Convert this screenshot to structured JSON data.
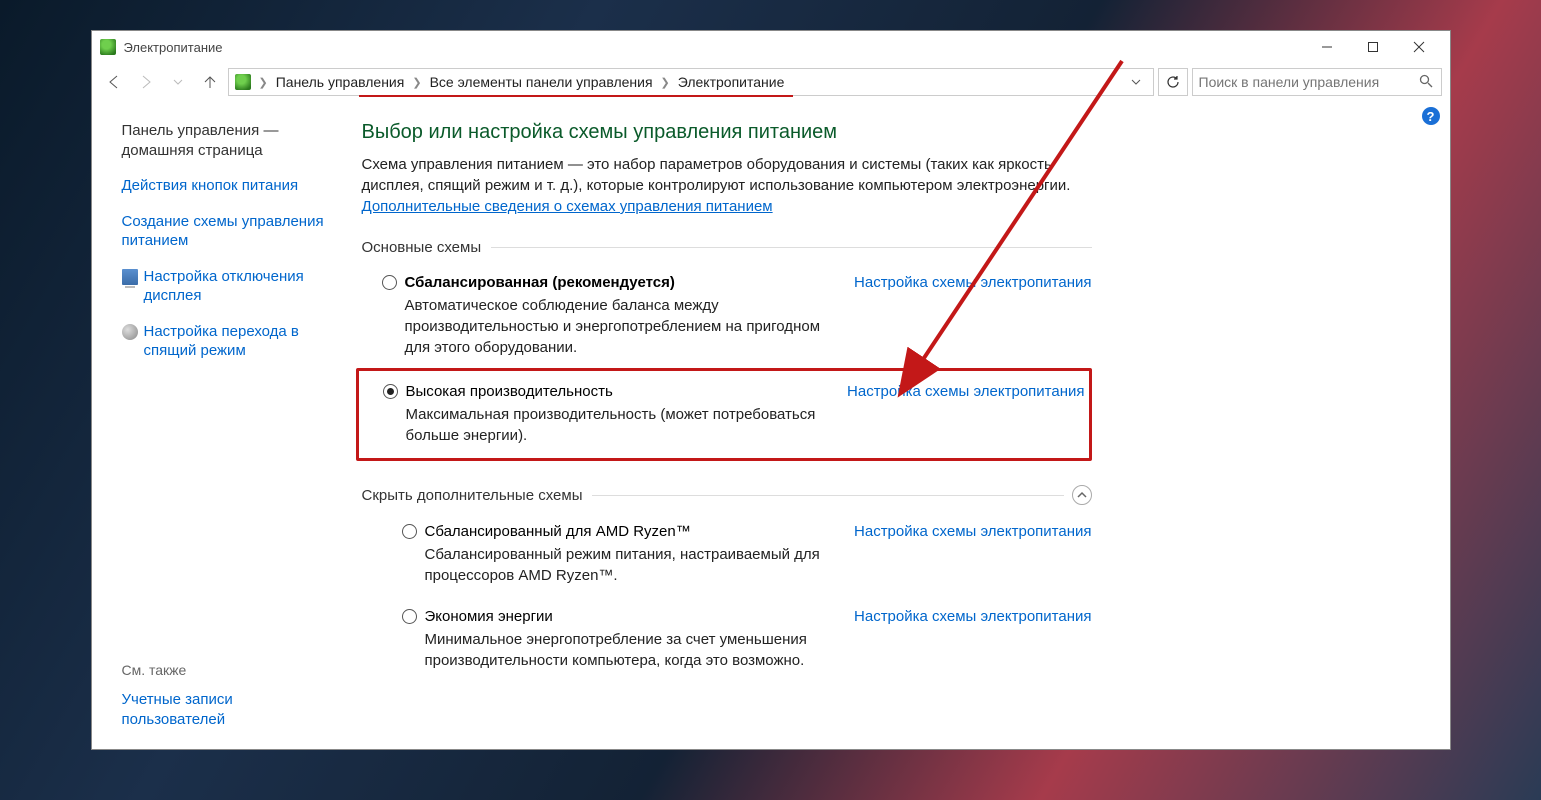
{
  "window": {
    "title": "Электропитание",
    "buttons": {
      "minimize": "—",
      "maximize": "□",
      "close": "✕"
    }
  },
  "nav": {
    "back": "←",
    "forward": "→",
    "up": "↑",
    "breadcrumb": {
      "item1": "Панель управления",
      "item2": "Все элементы панели управления",
      "item3": "Электропитание"
    },
    "search_placeholder": "Поиск в панели управления"
  },
  "sidebar": {
    "home1": "Панель управления —",
    "home2": "домашняя страница",
    "link_buttons": "Действия кнопок питания",
    "link_create1": "Создание схемы управления",
    "link_create2": "питанием",
    "link_display1": "Настройка отключения",
    "link_display2": "дисплея",
    "link_sleep1": "Настройка перехода в",
    "link_sleep2": "спящий режим"
  },
  "seealso": {
    "title": "См. также",
    "link1a": "Учетные записи",
    "link1b": "пользователей"
  },
  "main": {
    "heading": "Выбор или настройка схемы управления питанием",
    "desc": "Схема управления питанием — это набор параметров оборудования и системы (таких как яркость дисплея, спящий режим и т. д.), которые контролируют использование компьютером электроэнергии.",
    "info_link": "Дополнительные сведения о схемах управления питанием",
    "section1": "Основные схемы",
    "section2": "Скрыть дополнительные схемы",
    "configure": "Настройка схемы электропитания",
    "plans": {
      "balanced": {
        "name_a": "Сбалансированная",
        "name_b": " (рекомендуется)",
        "desc": "Автоматическое соблюдение баланса между производительностью и энергопотреблением на пригодном для этого оборудовании."
      },
      "high": {
        "name": "Высокая производительность",
        "desc": "Максимальная производительность (может потребоваться больше энергии)."
      },
      "ryzen": {
        "name": "Сбалансированный для AMD Ryzen™",
        "desc": "Сбалансированный режим питания, настраиваемый для процессоров AMD Ryzen™."
      },
      "eco": {
        "name": "Экономия энергии",
        "desc": "Минимальное энергопотребление за счет уменьшения производительности компьютера, когда это возможно."
      }
    }
  }
}
